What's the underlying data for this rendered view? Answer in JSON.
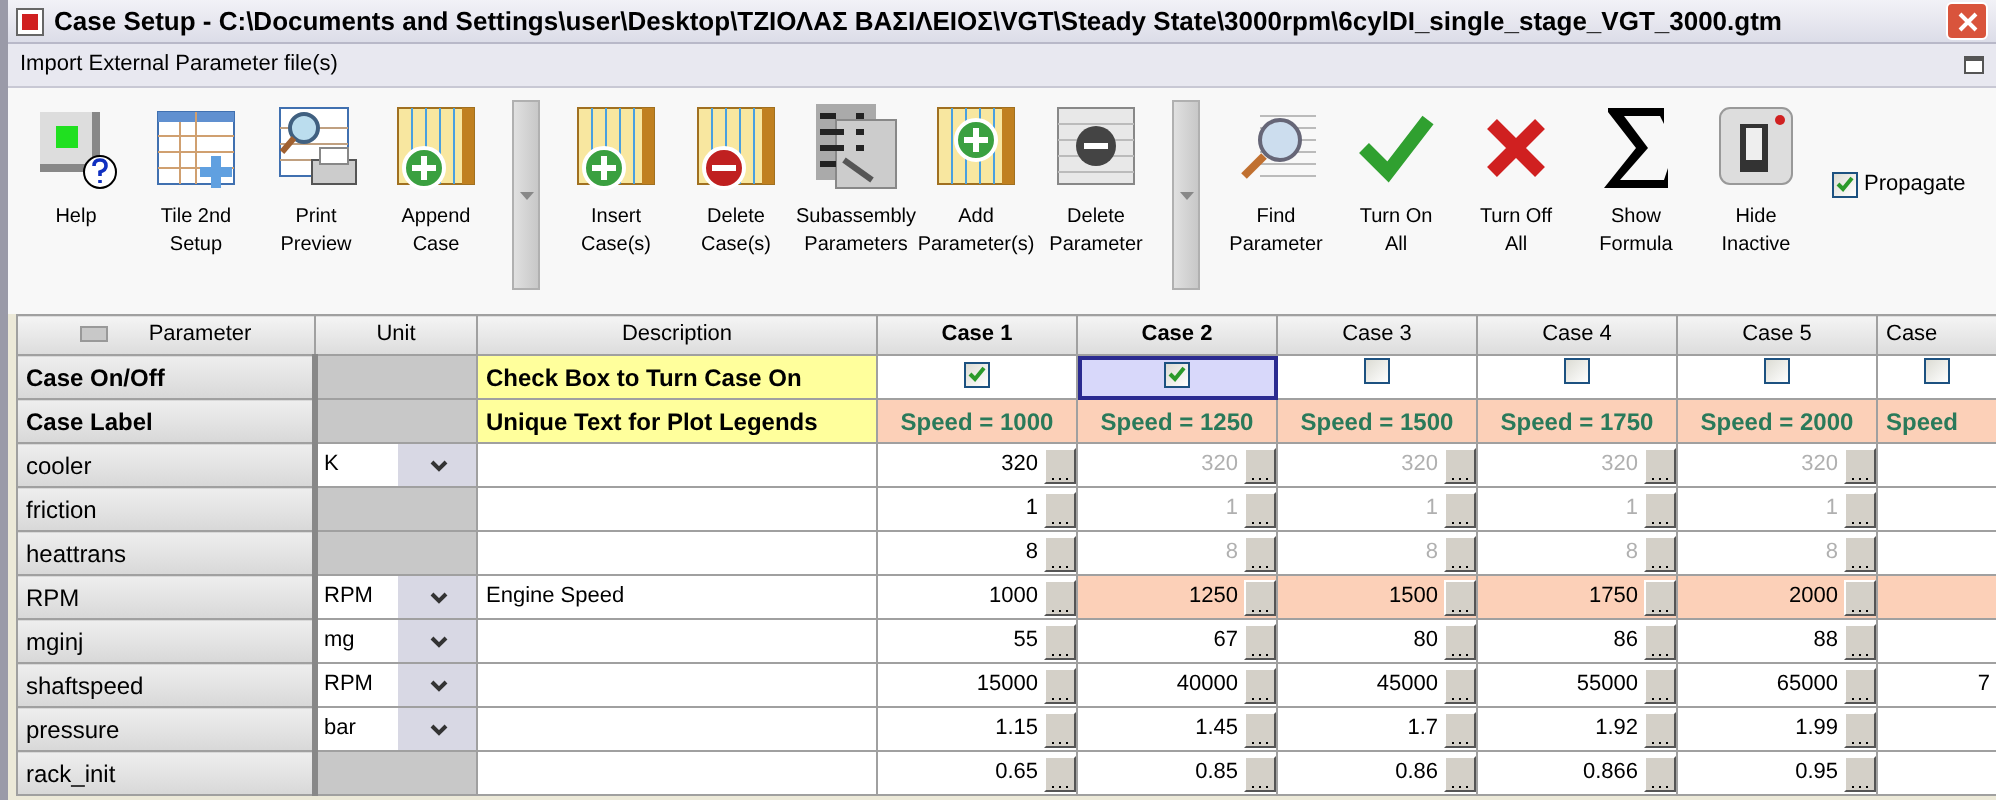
{
  "window": {
    "title": "Case Setup - C:\\Documents and Settings\\user\\Desktop\\ΤΖΙΟΛΑΣ ΒΑΣΙΛΕΙΟΣ\\VGT\\Steady State\\3000rpm\\6cylDI_single_stage_VGT_3000.gtm"
  },
  "menu": {
    "label": "Import External Parameter file(s)"
  },
  "toolbar": {
    "groups": [
      [
        {
          "label": "Help"
        },
        {
          "label": "Tile 2nd\nSetup"
        },
        {
          "label": "Print\nPreview"
        },
        {
          "label": "Append\nCase"
        }
      ],
      [
        {
          "label": "Insert\nCase(s)"
        },
        {
          "label": "Delete\nCase(s)"
        },
        {
          "label": "Subassembly\nParameters"
        },
        {
          "label": "Add\nParameter(s)"
        },
        {
          "label": "Delete\nParameter"
        }
      ],
      [
        {
          "label": "Find\nParameter"
        },
        {
          "label": "Turn On\nAll"
        },
        {
          "label": "Turn Off\nAll"
        },
        {
          "label": "Show\nFormula"
        },
        {
          "label": "Hide\nInactive"
        }
      ]
    ],
    "propagate": {
      "label": "Propagate",
      "checked": true
    }
  },
  "grid": {
    "columns": [
      "Parameter",
      "Unit",
      "Description"
    ],
    "cases": [
      {
        "header": "Case 1",
        "checked": true,
        "selected": false,
        "label": "Speed = 1000",
        "cut": false
      },
      {
        "header": "Case 2",
        "checked": true,
        "selected": true,
        "label": "Speed = 1250",
        "cut": false
      },
      {
        "header": "Case 3",
        "checked": false,
        "selected": false,
        "label": "Speed = 1500",
        "cut": false
      },
      {
        "header": "Case 4",
        "checked": false,
        "selected": false,
        "label": "Speed = 1750",
        "cut": false
      },
      {
        "header": "Case 5",
        "checked": false,
        "selected": false,
        "label": "Speed = 2000",
        "cut": false
      },
      {
        "header": "Case",
        "checked": false,
        "selected": false,
        "label": "Speed",
        "cut": true
      }
    ],
    "on_off_row": {
      "name": "Case On/Off",
      "description": "Check Box to Turn Case On"
    },
    "label_row": {
      "name": "Case Label",
      "description": "Unique Text for Plot Legends"
    },
    "rows": [
      {
        "name": "cooler",
        "unit": "K",
        "values": [
          {
            "text": "320",
            "dimmed": false
          },
          {
            "text": "320",
            "dimmed": true
          },
          {
            "text": "320",
            "dimmed": true
          },
          {
            "text": "320",
            "dimmed": true
          },
          {
            "text": "320",
            "dimmed": true
          }
        ]
      },
      {
        "name": "friction",
        "values": [
          {
            "text": "1",
            "dimmed": false
          },
          {
            "text": "1",
            "dimmed": true
          },
          {
            "text": "1",
            "dimmed": true
          },
          {
            "text": "1",
            "dimmed": true
          },
          {
            "text": "1",
            "dimmed": true
          }
        ]
      },
      {
        "name": "heattrans",
        "values": [
          {
            "text": "8",
            "dimmed": false
          },
          {
            "text": "8",
            "dimmed": true
          },
          {
            "text": "8",
            "dimmed": true
          },
          {
            "text": "8",
            "dimmed": true
          },
          {
            "text": "8",
            "dimmed": true
          }
        ]
      },
      {
        "name": "RPM",
        "unit": "RPM",
        "description": "Engine Speed",
        "values": [
          {
            "text": "1000",
            "highlighted": false
          },
          {
            "text": "1250",
            "highlighted": true
          },
          {
            "text": "1500",
            "highlighted": true
          },
          {
            "text": "1750",
            "highlighted": true
          },
          {
            "text": "2000",
            "highlighted": true
          },
          {
            "highlighted": true
          }
        ]
      },
      {
        "name": "mginj",
        "unit": "mg",
        "values": [
          {
            "text": "55"
          },
          {
            "text": "67"
          },
          {
            "text": "80"
          },
          {
            "text": "86"
          },
          {
            "text": "88"
          }
        ]
      },
      {
        "name": "shaftspeed",
        "unit": "RPM",
        "values": [
          {
            "text": "15000"
          },
          {
            "text": "40000"
          },
          {
            "text": "45000"
          },
          {
            "text": "55000"
          },
          {
            "text": "65000"
          },
          {
            "text": "7"
          }
        ]
      },
      {
        "name": "pressure",
        "unit": "bar",
        "values": [
          {
            "text": "1.15"
          },
          {
            "text": "1.45"
          },
          {
            "text": "1.7"
          },
          {
            "text": "1.92"
          },
          {
            "text": "1.99"
          }
        ]
      },
      {
        "name": "rack_init",
        "values": [
          {
            "text": "0.65"
          },
          {
            "text": "0.85"
          },
          {
            "text": "0.86"
          },
          {
            "text": "0.866"
          },
          {
            "text": "0.95"
          }
        ]
      }
    ]
  }
}
